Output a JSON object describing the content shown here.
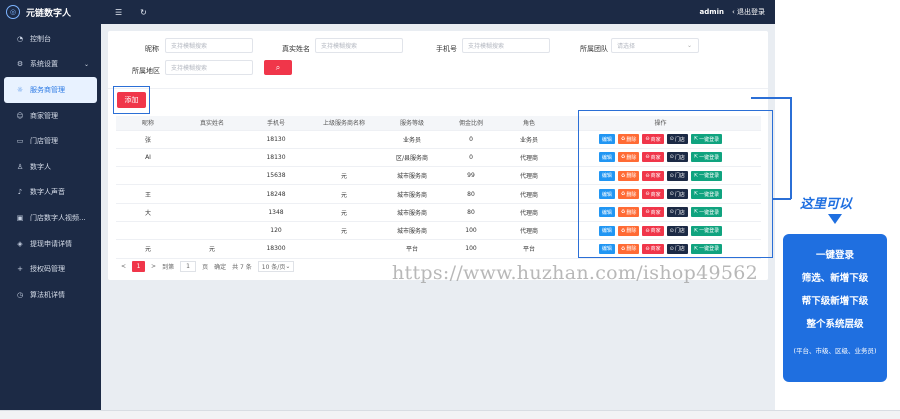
{
  "brand": {
    "title": "元链数字人"
  },
  "sidebar": {
    "items": [
      {
        "label": "控制台",
        "icon": "dashboard-icon",
        "active": false
      },
      {
        "label": "系统设置",
        "icon": "gear-icon",
        "active": false,
        "expandable": true
      },
      {
        "label": "服务商管理",
        "icon": "bulb-icon",
        "active": true
      },
      {
        "label": "商家管理",
        "icon": "smile-icon",
        "active": false
      },
      {
        "label": "门店管理",
        "icon": "store-icon",
        "active": false
      },
      {
        "label": "数字人",
        "icon": "person-icon",
        "active": false
      },
      {
        "label": "数字人声音",
        "icon": "music-icon",
        "active": false
      },
      {
        "label": "门店数字人视频...",
        "icon": "video-icon",
        "active": false
      },
      {
        "label": "提现申请详情",
        "icon": "layers-icon",
        "active": false
      },
      {
        "label": "授权码管理",
        "icon": "plus-icon",
        "active": false
      },
      {
        "label": "算法机详情",
        "icon": "clock-icon",
        "active": false
      }
    ]
  },
  "topbar": {
    "user": "admin",
    "logout": "退出登录"
  },
  "filters": {
    "nickname_label": "昵称",
    "nickname_placeholder": "支持模糊搜索",
    "realname_label": "真实姓名",
    "realname_placeholder": "支持模糊搜索",
    "phone_label": "手机号",
    "phone_placeholder": "支持模糊搜索",
    "team_label": "所属团队",
    "team_placeholder": "请选择",
    "region_label": "所属地区",
    "region_placeholder": "支持模糊搜索"
  },
  "add_button": "添加",
  "table": {
    "headers": [
      "昵称",
      "真实姓名",
      "手机号",
      "上级服务商名称",
      "服务等级",
      "佣金比例",
      "角色",
      "操作"
    ],
    "rows": [
      {
        "nick": "张",
        "real": "",
        "phone": "18130",
        "up": "",
        "level": "业务员",
        "ratio": "0",
        "role": "业务员"
      },
      {
        "nick": "AI",
        "real": "",
        "phone": "18130",
        "up": "",
        "level": "区/县服务商",
        "ratio": "0",
        "role": "代理商"
      },
      {
        "nick": "",
        "real": "",
        "phone": "15638",
        "up": "元",
        "level": "城市服务商",
        "ratio": "99",
        "role": "代理商"
      },
      {
        "nick": "王",
        "real": "",
        "phone": "18248",
        "up": "元",
        "level": "城市服务商",
        "ratio": "80",
        "role": "代理商"
      },
      {
        "nick": "大",
        "real": "",
        "phone": "1348",
        "up": "元",
        "level": "城市服务商",
        "ratio": "80",
        "role": "代理商"
      },
      {
        "nick": "",
        "real": "",
        "phone": "120",
        "up": "元",
        "level": "城市服务商",
        "ratio": "100",
        "role": "代理商"
      },
      {
        "nick": "元",
        "real": "元",
        "phone": "18300",
        "up": "",
        "level": "平台",
        "ratio": "100",
        "role": "平台"
      }
    ],
    "ops": {
      "edit": "编辑",
      "delete": "删除",
      "merchant": "商家",
      "store": "门店",
      "login": "一键登录"
    }
  },
  "pager": {
    "prev": "<",
    "current": "1",
    "next": ">",
    "goto_label": "到第",
    "goto_value": "1",
    "page_label": "页",
    "confirm": "确定",
    "total": "共 7 条",
    "page_size": "10 条/页"
  },
  "annotation": {
    "callout": "这里可以",
    "lines": [
      "一键登录",
      "筛选、新增下级",
      "帮下级新增下级",
      "整个系统层级"
    ],
    "note": "(平台、市级、区级、业务员)"
  },
  "watermark": "https://www.huzhan.com/ishop49562"
}
